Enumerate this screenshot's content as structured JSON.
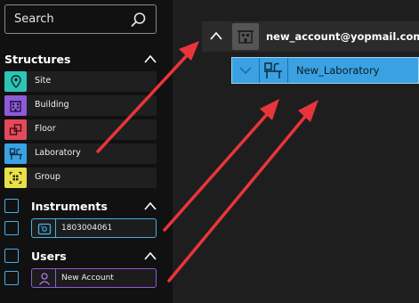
{
  "search": {
    "placeholder": "Search"
  },
  "structures": {
    "title": "Structures",
    "items": [
      {
        "label": "Site",
        "icon": "map-pin-icon",
        "color": "#2ec4b6"
      },
      {
        "label": "Building",
        "icon": "building-icon",
        "color": "#8e5bd8"
      },
      {
        "label": "Floor",
        "icon": "floor-icon",
        "color": "#e24a5a"
      },
      {
        "label": "Laboratory",
        "icon": "laboratory-icon",
        "color": "#3aa2e2"
      },
      {
        "label": "Group",
        "icon": "group-icon",
        "color": "#e8e04a"
      }
    ]
  },
  "instruments": {
    "title": "Instruments",
    "items": [
      {
        "label": "1803004061",
        "icon": "instrument-icon",
        "color": "#46b0e6"
      }
    ]
  },
  "users": {
    "title": "Users",
    "items": [
      {
        "label": "New Account",
        "icon": "user-icon",
        "color": "#8e5bd8"
      }
    ]
  },
  "tree": {
    "account": {
      "label": "new_account@yopmail.com",
      "icon": "account-icon"
    },
    "laboratory": {
      "label": "New_Laboratory",
      "icon": "laboratory-icon",
      "color": "#3aa2e2"
    }
  }
}
